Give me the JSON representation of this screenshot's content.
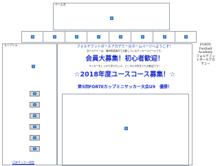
{
  "header": {
    "team_label": "チーム名"
  },
  "sidebar": {
    "emblem_label": "エンブレム",
    "footer_label": "日本サッカー協会"
  },
  "main": {
    "welcome_line": "フォルテフットボールアカデミーのホームページへようこそ！",
    "intro_line": "当アカデミーは、福岡県嘉麻市で活動しているサッカースクールです。",
    "member_heading": "会員大募集！初心者歓迎！",
    "member_sub": "サッカーをしっかり学びたい人、どこの小中学生でも大歓迎です！",
    "youth_heading": "☆2018年度ユースコース募集！☆",
    "news_heading": "第5回FORTEカップミニサッカー大会U9　優勝！"
  },
  "right_panel": {
    "title_lines": [
      "FORTE",
      "Football",
      "Academy",
      "フォルテフッ",
      "トボールアカ",
      "デミー"
    ]
  },
  "colors": {
    "heading_blue": "#1b2fd0",
    "frame_gray": "#9aa2aa",
    "cell_gray": "#d4d7da",
    "icon_blue": "#5aa0e6"
  }
}
